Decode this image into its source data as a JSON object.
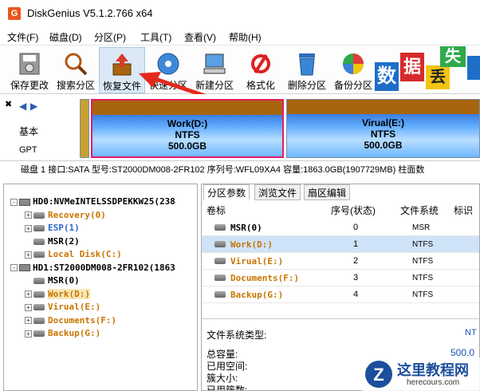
{
  "title": {
    "app_icon": "G",
    "text": "DiskGenius V5.1.2.766 x64"
  },
  "menu": [
    "文件(F)",
    "磁盘(D)",
    "分区(P)",
    "工具(T)",
    "查看(V)",
    "帮助(H)"
  ],
  "toolbar": {
    "save": "保存更改",
    "search": "搜索分区",
    "recover": "恢复文件",
    "quick": "快速分区",
    "new": "新建分区",
    "format": "格式化",
    "delete": "删除分区",
    "backup": "备份分区"
  },
  "logo": {
    "t1": "数",
    "t2": "据",
    "t3": "失",
    "t4": "丢"
  },
  "disk": {
    "type": "基本",
    "style": "GPT",
    "parts": [
      {
        "name": "Work(D:)",
        "fs": "NTFS",
        "size": "500.0GB"
      },
      {
        "name": "Virual(E:)",
        "fs": "NTFS",
        "size": "500.0GB"
      }
    ]
  },
  "diskinfo": "磁盘 1 接口:SATA  型号:ST2000DM008-2FR102  序列号:WFL09XA4  容量:1863.0GB(1907729MB)  柱面数",
  "tree": [
    {
      "label": "HD0:NVMeINTELSSDPEKKW25(238",
      "cls": ""
    },
    {
      "label": "Recovery(0)",
      "cls": "orange"
    },
    {
      "label": "ESP(1)",
      "cls": "blue"
    },
    {
      "label": "MSR(2)",
      "cls": ""
    },
    {
      "label": "Local Disk(C:)",
      "cls": "orange"
    },
    {
      "label": "HD1:ST2000DM008-2FR102(1863",
      "cls": ""
    },
    {
      "label": "MSR(0)",
      "cls": ""
    },
    {
      "label": "Work(D:)",
      "cls": "orange"
    },
    {
      "label": "Virual(E:)",
      "cls": "orange"
    },
    {
      "label": "Documents(F:)",
      "cls": "orange"
    },
    {
      "label": "Backup(G:)",
      "cls": "orange"
    }
  ],
  "tabs": [
    "分区参数",
    "浏览文件",
    "扇区编辑"
  ],
  "table": {
    "headers": [
      "卷标",
      "序号(状态)",
      "文件系统",
      "标识"
    ],
    "rows": [
      {
        "label": "MSR(0)",
        "cls": "",
        "idx": "0",
        "fs": "MSR"
      },
      {
        "label": "Work(D:)",
        "cls": "orange",
        "idx": "1",
        "fs": "NTFS"
      },
      {
        "label": "Virual(E:)",
        "cls": "orange",
        "idx": "2",
        "fs": "NTFS"
      },
      {
        "label": "Documents(F:)",
        "cls": "orange",
        "idx": "3",
        "fs": "NTFS"
      },
      {
        "label": "Backup(G:)",
        "cls": "orange",
        "idx": "4",
        "fs": "NTFS"
      }
    ]
  },
  "details": {
    "fstype_label": "文件系统类型:",
    "fstype_value": "NT",
    "total_label": "总容量:",
    "total_value": "500.0",
    "free_label": "已用空间:",
    "cluster_label": "簇大小:",
    "used_clusters_label": "已用簇数:"
  },
  "watermark": {
    "cn": "这里教程网",
    "url": "herecours.com"
  }
}
